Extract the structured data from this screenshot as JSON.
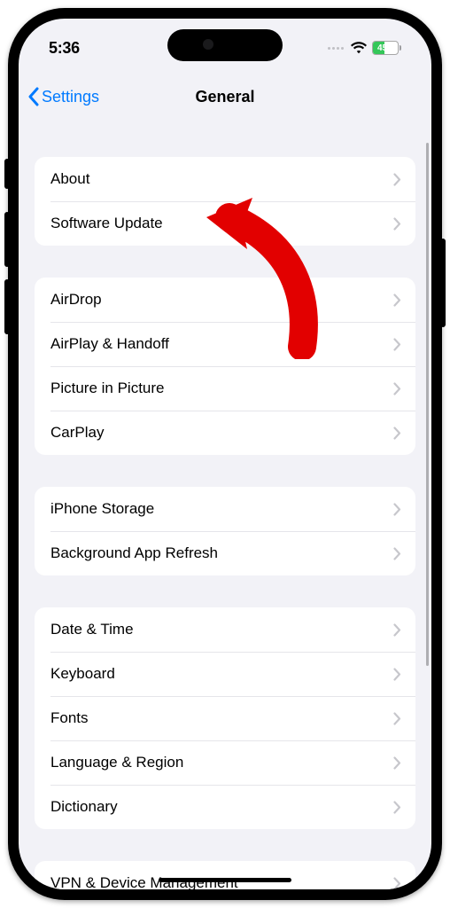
{
  "status": {
    "time": "5:36",
    "battery": "45"
  },
  "nav": {
    "back_label": "Settings",
    "title": "General"
  },
  "groups": [
    {
      "rows": [
        {
          "id": "about",
          "label": "About"
        },
        {
          "id": "software-update",
          "label": "Software Update"
        }
      ]
    },
    {
      "rows": [
        {
          "id": "airdrop",
          "label": "AirDrop"
        },
        {
          "id": "airplay-handoff",
          "label": "AirPlay & Handoff"
        },
        {
          "id": "picture-in-picture",
          "label": "Picture in Picture"
        },
        {
          "id": "carplay",
          "label": "CarPlay"
        }
      ]
    },
    {
      "rows": [
        {
          "id": "iphone-storage",
          "label": "iPhone Storage"
        },
        {
          "id": "background-app-refresh",
          "label": "Background App Refresh"
        }
      ]
    },
    {
      "rows": [
        {
          "id": "date-time",
          "label": "Date & Time"
        },
        {
          "id": "keyboard",
          "label": "Keyboard"
        },
        {
          "id": "fonts",
          "label": "Fonts"
        },
        {
          "id": "language-region",
          "label": "Language & Region"
        },
        {
          "id": "dictionary",
          "label": "Dictionary"
        }
      ]
    },
    {
      "rows": [
        {
          "id": "vpn-device-management",
          "label": "VPN & Device Management"
        }
      ]
    }
  ]
}
